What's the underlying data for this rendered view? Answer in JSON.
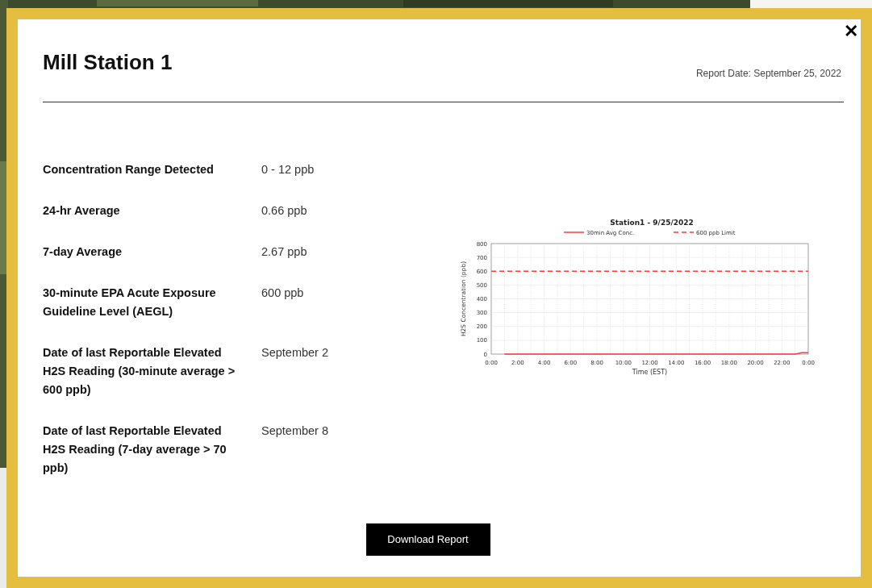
{
  "modal": {
    "title": "Mill Station 1",
    "close": "✕",
    "report_date": "Report Date: September 25, 2022"
  },
  "details": [
    {
      "label": "Concentration Range Detected",
      "value": "0 - 12 ppb"
    },
    {
      "label": "24-hr Average",
      "value": "0.66 ppb"
    },
    {
      "label": "7-day Average",
      "value": "2.67 ppb"
    },
    {
      "label": "30-minute EPA Acute Exposure Guideline Level (AEGL)",
      "value": "600 ppb"
    },
    {
      "label": "Date of last Reportable Elevated H2S Reading (30-minute average > 600 ppb)",
      "value": "September 2"
    },
    {
      "label": "Date of last Reportable Elevated H2S Reading (7-day average > 70 ppb)",
      "value": "September 8"
    }
  ],
  "chart_data": {
    "type": "line",
    "title": "Station1  - 9/25/2022",
    "xlabel": "Time (EST)",
    "ylabel": "H2S Concentration (ppb)",
    "x": [
      0,
      1,
      2,
      3,
      4,
      5,
      6,
      7,
      8,
      9,
      10,
      11,
      12,
      13,
      14,
      15,
      16,
      17,
      18,
      19,
      20,
      21,
      22,
      23,
      23.5,
      24
    ],
    "series": [
      {
        "name": "30min Avg Conc.",
        "color": "#ff3b3b",
        "line_style": "solid",
        "values": [
          null,
          0,
          0,
          0,
          0,
          0,
          0,
          0,
          0,
          0,
          0,
          0,
          0,
          0,
          0,
          0,
          0,
          0,
          0,
          0,
          0,
          0,
          0,
          0,
          10,
          10
        ]
      },
      {
        "name": "600 ppb Limit",
        "color": "#ff3b3b",
        "line_style": "dashed",
        "values": [
          600,
          600,
          600,
          600,
          600,
          600,
          600,
          600,
          600,
          600,
          600,
          600,
          600,
          600,
          600,
          600,
          600,
          600,
          600,
          600,
          600,
          600,
          600,
          600,
          600,
          600
        ]
      }
    ],
    "grid": true,
    "legend": true,
    "xlim": [
      0,
      24
    ],
    "ylim": [
      0,
      800
    ],
    "xticks": [
      {
        "value": 0,
        "label": "0:00"
      },
      {
        "value": 2,
        "label": "2:00"
      },
      {
        "value": 4,
        "label": "4:00"
      },
      {
        "value": 6,
        "label": "6:00"
      },
      {
        "value": 8,
        "label": "8:00"
      },
      {
        "value": 10,
        "label": "10:00"
      },
      {
        "value": 12,
        "label": "12:00"
      },
      {
        "value": 14,
        "label": "14:00"
      },
      {
        "value": 16,
        "label": "16:00"
      },
      {
        "value": 18,
        "label": "18:00"
      },
      {
        "value": 20,
        "label": "20:00"
      },
      {
        "value": 22,
        "label": "22:00"
      },
      {
        "value": 24,
        "label": "0:00"
      }
    ],
    "yticks": [
      0,
      100,
      200,
      300,
      400,
      500,
      600,
      700,
      800
    ]
  },
  "download_button": "Download Report"
}
